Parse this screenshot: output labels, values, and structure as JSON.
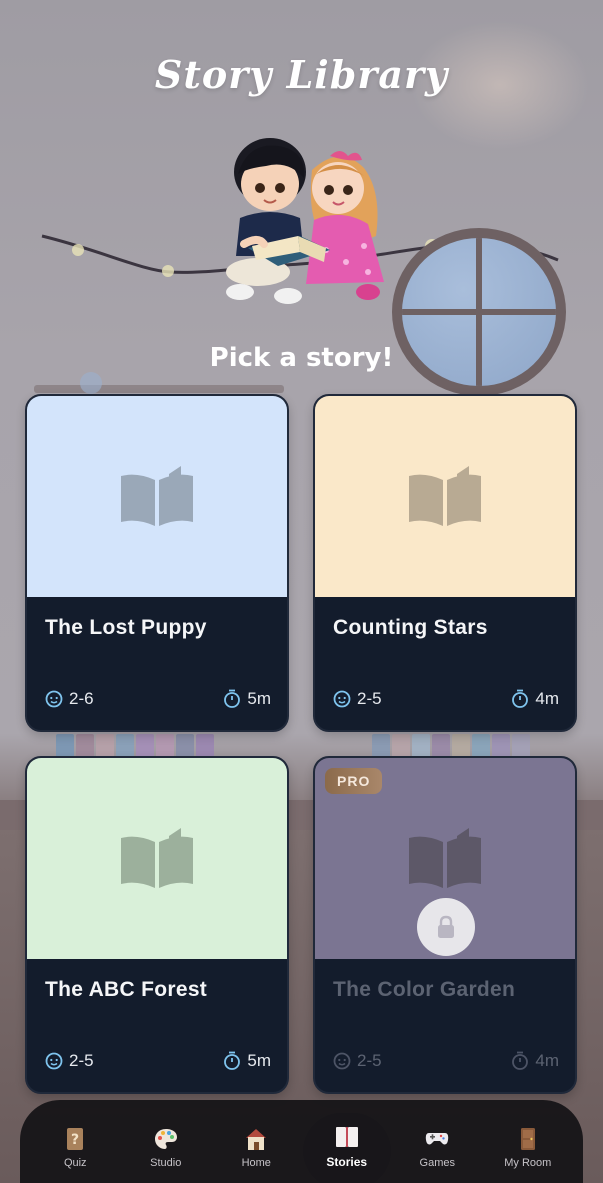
{
  "header": {
    "title": "Story Library",
    "subtitle": "Pick a story!"
  },
  "stories": [
    {
      "title": "The Lost Puppy",
      "age": "2-6",
      "duration": "5m",
      "cover_color": "#d3e4fb",
      "icon_color": "#9aa8b8",
      "locked": false
    },
    {
      "title": "Counting Stars",
      "age": "2-5",
      "duration": "4m",
      "cover_color": "#fae8c9",
      "icon_color": "#b8aa93",
      "locked": false
    },
    {
      "title": "The ABC Forest",
      "age": "2-5",
      "duration": "5m",
      "cover_color": "#d9f0d9",
      "icon_color": "#9cb09c",
      "locked": false
    },
    {
      "title": "The Color Garden",
      "age": "2-5",
      "duration": "4m",
      "cover_color": "#7b7592",
      "icon_color": "#5d5868",
      "locked": true,
      "badge": "PRO"
    }
  ],
  "nav": {
    "items": [
      {
        "label": "Quiz",
        "icon": "question-box-icon",
        "active": false
      },
      {
        "label": "Studio",
        "icon": "palette-icon",
        "active": false
      },
      {
        "label": "Home",
        "icon": "house-icon",
        "active": false
      },
      {
        "label": "Stories",
        "icon": "book-icon",
        "active": true
      },
      {
        "label": "Games",
        "icon": "gamepad-icon",
        "active": false
      },
      {
        "label": "My Room",
        "icon": "door-icon",
        "active": false
      }
    ]
  },
  "colors": {
    "card_bg": "#131c2c",
    "accent_icon": "#7fc4ee",
    "pro_badge": "#9c7b5d"
  }
}
